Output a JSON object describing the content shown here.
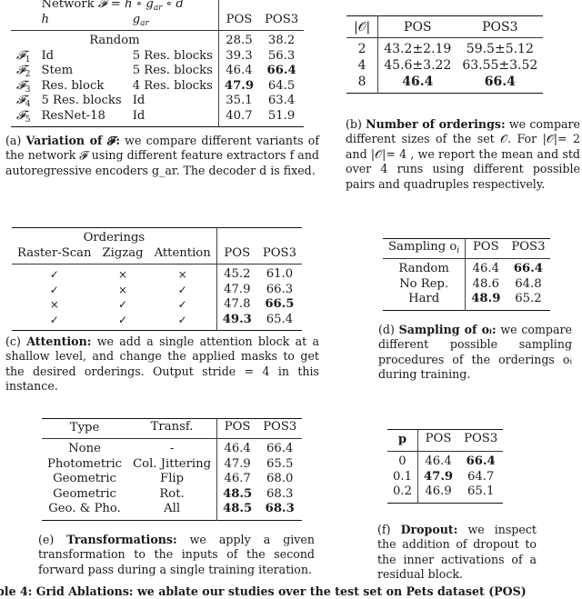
{
  "table_a": {
    "header_group": "Network 𝓕 = h ∘ g_ar ∘ d",
    "header_group_parts": {
      "prefix": "Network ",
      "F": "𝓕",
      "eq": " = ",
      "h": "h",
      "o1": " ∘ ",
      "g": "g",
      "g_sub": "ar",
      "o2": " ∘ ",
      "d": "d"
    },
    "col_h": "h",
    "col_g": "g",
    "col_g_sub": "ar",
    "col_pos": "POS",
    "col_pos3": "POS3",
    "random_row": {
      "label": "Random",
      "pos": "28.5",
      "pos3": "38.2"
    },
    "rows": [
      {
        "name": "𝓕",
        "sub": "1",
        "h": "Id",
        "g": "5 Res. blocks",
        "pos": "39.3",
        "pos3": "56.3",
        "bold_pos": false,
        "bold_pos3": false
      },
      {
        "name": "𝓕",
        "sub": "2",
        "h": "Stem",
        "g": "5 Res. blocks",
        "pos": "46.4",
        "pos3": "66.4",
        "bold_pos": false,
        "bold_pos3": true
      },
      {
        "name": "𝓕",
        "sub": "3",
        "h": "Res. block",
        "g": "4 Res. blocks",
        "pos": "47.9",
        "pos3": "64.5",
        "bold_pos": true,
        "bold_pos3": false
      },
      {
        "name": "𝓕",
        "sub": "4",
        "h": "5 Res. blocks",
        "g": "Id",
        "pos": "35.1",
        "pos3": "63.4",
        "bold_pos": false,
        "bold_pos3": false
      },
      {
        "name": "𝓕",
        "sub": "5",
        "h": "ResNet-18",
        "g": "Id",
        "pos": "40.7",
        "pos3": "51.9",
        "bold_pos": false,
        "bold_pos3": false
      }
    ],
    "caption": {
      "tag": "(a) ",
      "title": "Variation of 𝓕:",
      "body": " we compare different variants of the network 𝓕 using different feature extractors f and autoregressive encoders g_ar. The decoder d is fixed."
    }
  },
  "table_b": {
    "col_o": "|𝒪|",
    "col_pos": "POS",
    "col_pos3": "POS3",
    "rows": [
      {
        "o": "2",
        "pos": "43.2±2.19",
        "pos3": "59.5±5.12",
        "bold": false
      },
      {
        "o": "4",
        "pos": "45.6±3.22",
        "pos3": "63.55±3.52",
        "bold": false
      },
      {
        "o": "8",
        "pos": "46.4",
        "pos3": "66.4",
        "bold": true
      }
    ],
    "caption": {
      "tag": "(b) ",
      "title": "Number of orderings:",
      "body": " we compare different sizes of the set 𝒪. For |𝒪|= 2 and |𝒪|= 4 , we report the mean and std over 4 runs using different possible pairs and quadruples respectively."
    }
  },
  "table_c": {
    "header_group": "Orderings",
    "cols": [
      "Raster-Scan",
      "Zigzag",
      "Attention",
      "POS",
      "POS3"
    ],
    "rows": [
      {
        "raster": "✓",
        "zigzag": "×",
        "attention": "×",
        "pos": "45.2",
        "pos3": "61.0",
        "bold_pos": false,
        "bold_pos3": false
      },
      {
        "raster": "✓",
        "zigzag": "×",
        "attention": "✓",
        "pos": "47.9",
        "pos3": "66.3",
        "bold_pos": false,
        "bold_pos3": false
      },
      {
        "raster": "×",
        "zigzag": "✓",
        "attention": "✓",
        "pos": "47.8",
        "pos3": "66.5",
        "bold_pos": false,
        "bold_pos3": true
      },
      {
        "raster": "✓",
        "zigzag": "✓",
        "attention": "✓",
        "pos": "49.3",
        "pos3": "65.4",
        "bold_pos": true,
        "bold_pos3": false
      }
    ],
    "caption": {
      "tag": "(c) ",
      "title": "Attention:",
      "body": " we add a single attention block at a shallow level, and change the applied masks to get the desired orderings. Output stride = 4 in this instance."
    }
  },
  "table_d": {
    "col_s": "Sampling o",
    "col_s_sub": "i",
    "col_pos": "POS",
    "col_pos3": "POS3",
    "rows": [
      {
        "s": "Random",
        "pos": "46.4",
        "pos3": "66.4",
        "bold_pos": false,
        "bold_pos3": true
      },
      {
        "s": "No Rep.",
        "pos": "48.6",
        "pos3": "64.8",
        "bold_pos": false,
        "bold_pos3": false
      },
      {
        "s": "Hard",
        "pos": "48.9",
        "pos3": "65.2",
        "bold_pos": true,
        "bold_pos3": false
      }
    ],
    "caption": {
      "tag": "(d) ",
      "title": "Sampling of oᵢ:",
      "body": " we compare different possible sampling procedures of the orderings oᵢ during training."
    }
  },
  "table_e": {
    "cols": [
      "Type",
      "Transf.",
      "POS",
      "POS3"
    ],
    "rows": [
      {
        "type": "None",
        "transf": "-",
        "pos": "46.4",
        "pos3": "66.4",
        "bold_pos": false,
        "bold_pos3": false
      },
      {
        "type": "Photometric",
        "transf": "Col. Jittering",
        "pos": "47.9",
        "pos3": "65.5",
        "bold_pos": false,
        "bold_pos3": false
      },
      {
        "type": "Geometric",
        "transf": "Flip",
        "pos": "46.7",
        "pos3": "68.0",
        "bold_pos": false,
        "bold_pos3": false
      },
      {
        "type": "Geometric",
        "transf": "Rot.",
        "pos": "48.5",
        "pos3": "68.3",
        "bold_pos": true,
        "bold_pos3": false
      },
      {
        "type": "Geo. & Pho.",
        "transf": "All",
        "pos": "48.5",
        "pos3": "68.3",
        "bold_pos": true,
        "bold_pos3": true
      }
    ],
    "caption": {
      "tag": "(e) ",
      "title": "Transformations:",
      "body": " we apply a given transformation to the inputs of the second forward pass during a single training iteration."
    }
  },
  "table_f": {
    "col_p": "p",
    "col_pos": "POS",
    "col_pos3": "POS3",
    "rows": [
      {
        "p": "0",
        "pos": "46.4",
        "pos3": "66.4",
        "bold_pos": false,
        "bold_pos3": true
      },
      {
        "p": "0.1",
        "pos": "47.9",
        "pos3": "64.7",
        "bold_pos": true,
        "bold_pos3": false
      },
      {
        "p": "0.2",
        "pos": "46.9",
        "pos3": "65.1",
        "bold_pos": false,
        "bold_pos3": false
      }
    ],
    "caption": {
      "tag": "(f) ",
      "title": "Dropout:",
      "body": " we inspect the addition of dropout to the inner activations of a residual block."
    }
  },
  "footer_fragment": "ble 4: Grid Ablations: we ablate our studies over the test set on Pets dataset (POS)"
}
